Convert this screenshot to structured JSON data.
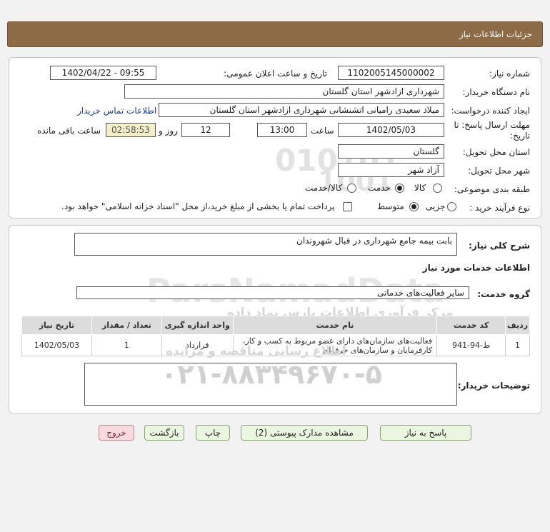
{
  "header": {
    "title": "جزئیات اطلاعات نیاز"
  },
  "form": {
    "need_number_label": "شماره نیاز:",
    "need_number": "1102005145000002",
    "announce_label": "تاریخ و ساعت اعلان عمومی:",
    "announce_value": "1402/04/22 - 09:55",
    "buyer_label": "نام دستگاه خریدار:",
    "buyer_value": "شهرداری ازادشهر استان گلستان",
    "creator_label": "ایجاد کننده درخواست:",
    "creator_value": "میلاد سعیدی رامیانی اتشنشانی  شهرداری ازادشهر استان گلستان",
    "contact_link": "اطلاعات تماس خریدار",
    "deadline_label_line1": "مهلت ارسال پاسخ: تا",
    "deadline_label_line2": "تاریخ:",
    "deadline_date": "1402/05/03",
    "time_label": "ساعت",
    "deadline_time": "13:00",
    "days_value": "12",
    "days_label": "روز و",
    "remaining_time": "02:58:53",
    "remaining_label": "ساعت باقی مانده",
    "province_label": "استان محل تحویل:",
    "province_value": "گلستان",
    "city_label": "شهر محل تحویل:",
    "city_value": "آزاد شهر",
    "category_label": "طبقه بندی موضوعی:",
    "category_options": [
      "کالا",
      "خدمت",
      "کالا/خدمت"
    ],
    "category_selected": "خدمت",
    "purchase_type_label": "نوع فرآیند خرید :",
    "purchase_options": [
      "جزیی",
      "متوسط"
    ],
    "purchase_selected": "متوسط",
    "payment_note": "پرداخت تمام یا بخشی از مبلغ خرید،از محل \"اسناد خزانه اسلامی\" خواهد بود."
  },
  "details": {
    "summary_label": "شرح کلی نیاز:",
    "summary_value": "بابت بیمه جامع شهرداری در قبال شهروندان",
    "services_title": "اطلاعات خدمات مورد نیاز",
    "service_group_label": "گروه خدمت:",
    "service_group_value": "سایر فعالیت‌های خدماتی",
    "table": {
      "headers": [
        "ردیف",
        "کد خدمت",
        "نام خدمت",
        "واحد اندازه گیری",
        "تعداد / مقدار",
        "تاریخ نیاز"
      ],
      "rows": [
        [
          "1",
          "ط-94-941",
          "فعالیت‌های سازمان‌های دارای عضو مربوط به کسب و کار، کارفرمایان و سازمان‌های حرفه‌ای",
          "قرارداد",
          "1",
          "1402/05/03"
        ]
      ]
    },
    "buyer_notes_label": "توضیحات خریدار:",
    "buyer_notes_value": ""
  },
  "buttons": {
    "reply": "پاسخ به نیاز",
    "attachments": "مشاهده مدارک پیوستی (2)",
    "print": "چاپ",
    "back": "بازگشت",
    "exit": "خروج"
  },
  "watermark": {
    "brand": "ParsNamadData",
    "phone": "۰۲۱-۸۸۳۴۹۶۷۰-۵",
    "tagline1": "مرکز فرآوری اطلاعات پارس نماد داده",
    "tagline2": "اطلاع رسانی مناقصه و مزایده",
    "digits1": "010101",
    "digits2": "1001"
  },
  "colors": {
    "header_bg": "#8c6b46",
    "remaining_bg": "#f4eeca",
    "link": "#1c3f94",
    "exit_bg": "#f7d9de"
  }
}
